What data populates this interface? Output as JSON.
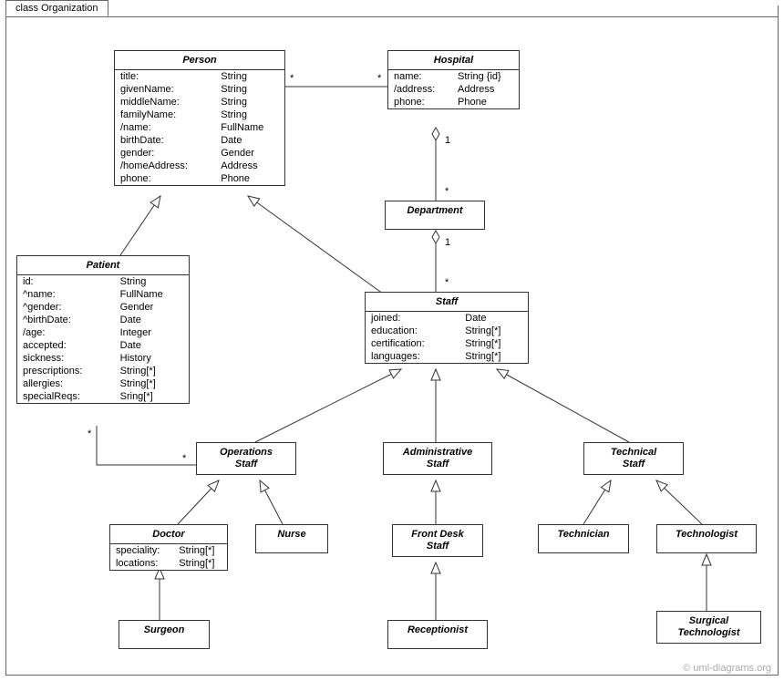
{
  "frame_title": "class Organization",
  "watermark": "© uml-diagrams.org",
  "classes": {
    "person": {
      "name": "Person",
      "attrs": [
        [
          "title:",
          "String"
        ],
        [
          "givenName:",
          "String"
        ],
        [
          "middleName:",
          "String"
        ],
        [
          "familyName:",
          "String"
        ],
        [
          "/name:",
          "FullName"
        ],
        [
          "birthDate:",
          "Date"
        ],
        [
          "gender:",
          "Gender"
        ],
        [
          "/homeAddress:",
          "Address"
        ],
        [
          "phone:",
          "Phone"
        ]
      ]
    },
    "hospital": {
      "name": "Hospital",
      "attrs": [
        [
          "name:",
          "String {id}"
        ],
        [
          "/address:",
          "Address"
        ],
        [
          "phone:",
          "Phone"
        ]
      ]
    },
    "department": {
      "name": "Department"
    },
    "patient": {
      "name": "Patient",
      "attrs": [
        [
          "id:",
          "String"
        ],
        [
          "^name:",
          "FullName"
        ],
        [
          "^gender:",
          "Gender"
        ],
        [
          "^birthDate:",
          "Date"
        ],
        [
          "/age:",
          "Integer"
        ],
        [
          "accepted:",
          "Date"
        ],
        [
          "sickness:",
          "History"
        ],
        [
          "prescriptions:",
          "String[*]"
        ],
        [
          "allergies:",
          "String[*]"
        ],
        [
          "specialReqs:",
          "Sring[*]"
        ]
      ]
    },
    "staff": {
      "name": "Staff",
      "attrs": [
        [
          "joined:",
          "Date"
        ],
        [
          "education:",
          "String[*]"
        ],
        [
          "certification:",
          "String[*]"
        ],
        [
          "languages:",
          "String[*]"
        ]
      ]
    },
    "operations_staff": {
      "name": "Operations",
      "sub": "Staff"
    },
    "administrative_staff": {
      "name": "Administrative",
      "sub": "Staff"
    },
    "technical_staff": {
      "name": "Technical",
      "sub": "Staff"
    },
    "doctor": {
      "name": "Doctor",
      "attrs": [
        [
          "speciality:",
          "String[*]"
        ],
        [
          "locations:",
          "String[*]"
        ]
      ]
    },
    "nurse": {
      "name": "Nurse"
    },
    "front_desk_staff": {
      "name": "Front Desk",
      "sub": "Staff"
    },
    "receptionist": {
      "name": "Receptionist"
    },
    "technician": {
      "name": "Technician"
    },
    "technologist": {
      "name": "Technologist"
    },
    "surgical_technologist": {
      "name": "Surgical",
      "sub": "Technologist"
    },
    "surgeon": {
      "name": "Surgeon"
    }
  },
  "multiplicities": {
    "person_hospital_left": "*",
    "person_hospital_right": "*",
    "hospital_dept_top": "1",
    "hospital_dept_bottom": "*",
    "dept_staff_top": "1",
    "dept_staff_bottom": "*",
    "patient_ops_left": "*",
    "patient_ops_right": "*"
  }
}
